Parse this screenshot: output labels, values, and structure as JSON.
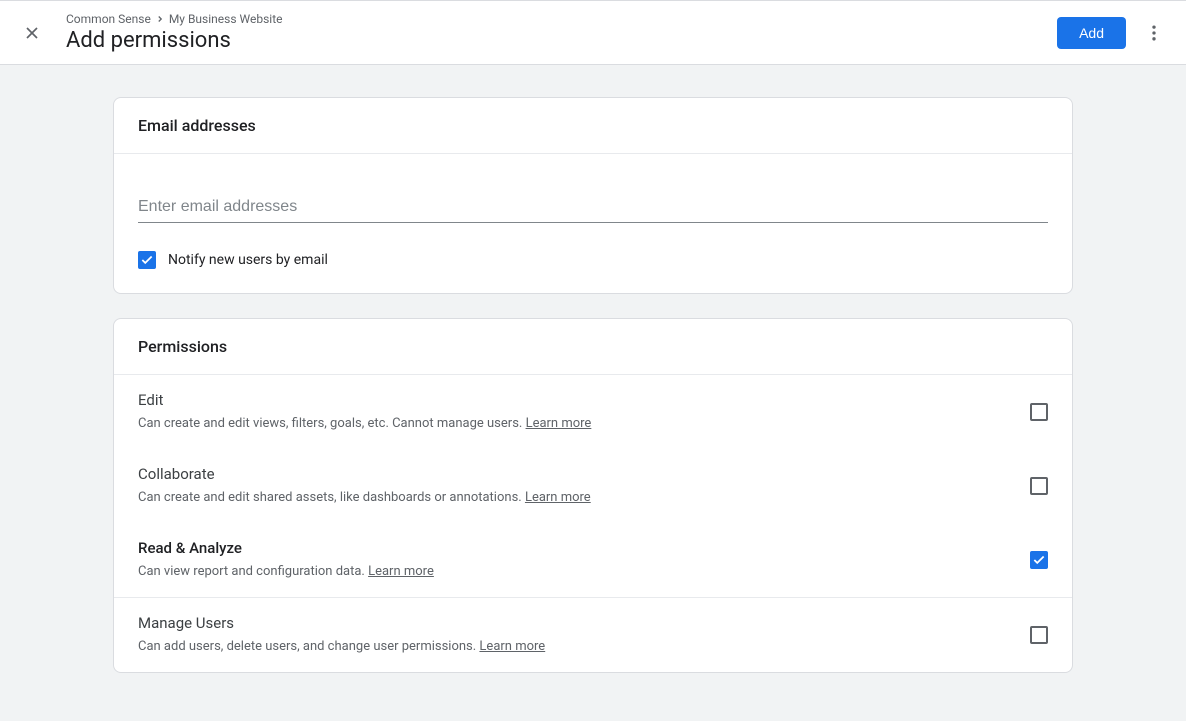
{
  "header": {
    "breadcrumb_parent": "Common Sense",
    "breadcrumb_child": "My Business Website",
    "title": "Add permissions",
    "add_button": "Add"
  },
  "email_card": {
    "header": "Email addresses",
    "placeholder": "Enter email addresses",
    "notify_label": "Notify new users by email",
    "notify_checked": true
  },
  "permissions_card": {
    "header": "Permissions",
    "learn_more": "Learn more",
    "items": [
      {
        "title": "Edit",
        "desc": "Can create and edit views, filters, goals, etc. Cannot manage users.",
        "checked": false
      },
      {
        "title": "Collaborate",
        "desc": "Can create and edit shared assets, like dashboards or annotations.",
        "checked": false
      },
      {
        "title": "Read & Analyze",
        "desc": "Can view report and configuration data.",
        "checked": true
      },
      {
        "title": "Manage Users",
        "desc": "Can add users, delete users, and change user permissions.",
        "checked": false
      }
    ]
  }
}
